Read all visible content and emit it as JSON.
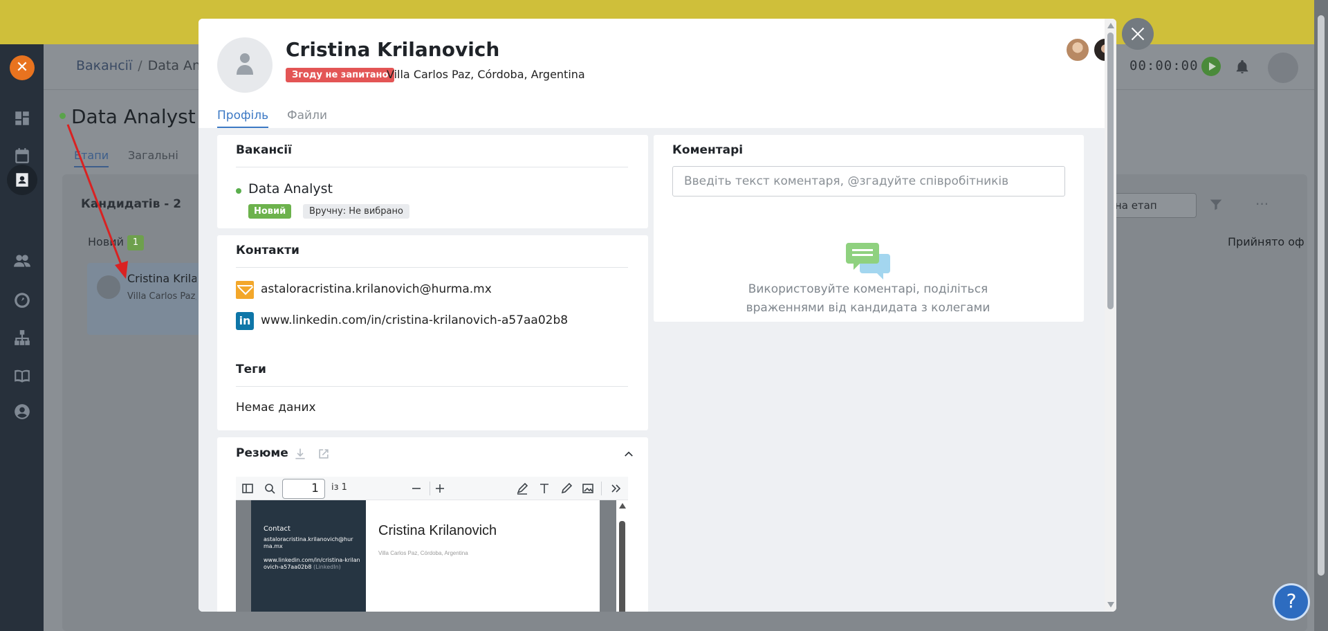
{
  "background": {
    "banner_partial_button": "",
    "breadcrumb": {
      "root": "Вакансії",
      "separator": "/",
      "current": "Data Anal"
    },
    "timer": "00:00:00",
    "job_title": "Data Analyst",
    "tabs": [
      "Етапи",
      "Загальні"
    ],
    "candidates_count": "Кандидатів - 2",
    "column_new": {
      "label": "Новий",
      "count": "1"
    },
    "card": {
      "name": "Cristina Krilanovich",
      "location": "Villa Carlos Paz, C"
    },
    "stage_select": "і на етап",
    "column_right": "Прийнято оф",
    "help_label": "?"
  },
  "modal": {
    "candidate_name": "Cristina Krilanovich",
    "consent_badge": "Згоду не запитано",
    "location": "Villa Carlos Paz, Córdoba, Argentina",
    "tabs": {
      "profile": "Профіль",
      "files": "Файли"
    },
    "vacancies": {
      "title": "Вакансії",
      "item_name": "Data Analyst",
      "stage_badge": "Новий",
      "source_badge": "Вручну: Не вибрано"
    },
    "contacts": {
      "title": "Контакти",
      "email": "astaloracristina.krilanovich@hurma.mx",
      "linkedin": "www.linkedin.com/in/cristina-krilanovich-a57aa02b8"
    },
    "tags": {
      "title": "Теги",
      "empty": "Немає даних"
    },
    "resume": {
      "title": "Резюме",
      "pdf": {
        "page_value": "1",
        "page_of": "із 1",
        "contact_heading": "Contact",
        "email": "astaloracristina.krilanovich@hurma.mx",
        "linkedin": "www.linkedin.com/in/cristina-krilanovich-a57aa02b8",
        "linkedin_suffix": "(LinkedIn)",
        "name": "Cristina Krilanovich",
        "location": "Villa Carlos Paz, Córdoba, Argentina"
      }
    },
    "comments": {
      "title": "Коментарі",
      "placeholder": "Введіть текст коментаря, @згадуйте співробітників",
      "empty_hint": "Використовуйте коментарі, поділіться враженнями від кандидата з колегами"
    }
  },
  "colors": {
    "accent": "#3b78c4",
    "consent_red": "#e35555",
    "stage_green": "#6cb24c",
    "email_icon": "#f3a72a",
    "linkedin_icon": "#0e76a8",
    "banner_yellow": "#cfbf3a"
  },
  "icons": [
    "x-logo-icon",
    "dashboard-icon",
    "calendar-icon",
    "candidates-icon",
    "team-icon",
    "speedometer-icon",
    "org-icon",
    "book-icon",
    "profile-icon",
    "play-icon",
    "bell-icon",
    "filter-icon",
    "close-icon",
    "mail-icon",
    "linkedin-icon",
    "download-icon",
    "external-link-icon",
    "chevron-up-icon",
    "comments-icon"
  ]
}
